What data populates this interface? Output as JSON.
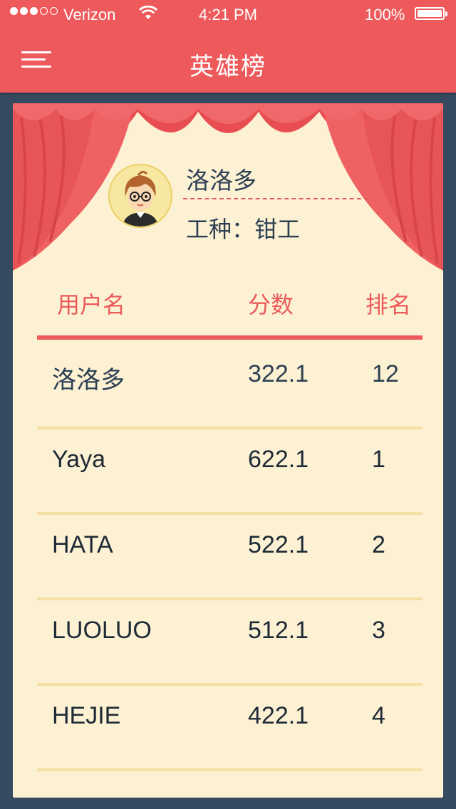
{
  "status_bar": {
    "carrier": "Verizon",
    "time": "4:21 PM",
    "battery": "100%"
  },
  "header": {
    "title": "英雄榜"
  },
  "profile": {
    "name": "洛洛多",
    "job": "工种：钳工"
  },
  "table": {
    "columns": [
      "用户名",
      "分数",
      "排名"
    ],
    "rows": [
      {
        "name": "洛洛多",
        "score": "322.1",
        "rank": "12"
      },
      {
        "name": "Yaya",
        "score": "622.1",
        "rank": "1"
      },
      {
        "name": "HATA",
        "score": "522.1",
        "rank": "2"
      },
      {
        "name": "LUOLUO",
        "score": "512.1",
        "rank": "3"
      },
      {
        "name": "HEJIE",
        "score": "422.1",
        "rank": "4"
      }
    ]
  },
  "colors": {
    "accent": "#ee5a5c",
    "background": "#354a5f",
    "card": "#fdf1d3",
    "text": "#2d4054"
  }
}
